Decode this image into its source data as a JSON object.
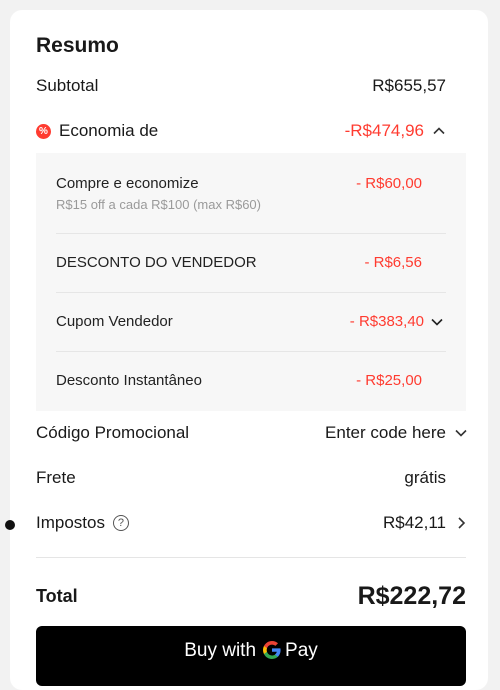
{
  "summary": {
    "title": "Resumo",
    "subtotal_label": "Subtotal",
    "subtotal_value": "R$655,57",
    "savings_label": "Economia de",
    "savings_value": "-R$474,96",
    "discounts": [
      {
        "label": "Compre e economize",
        "sub": "R$15 off a cada R$100 (max R$60)",
        "value": "- R$60,00"
      },
      {
        "label": "DESCONTO DO VENDEDOR",
        "value": "- R$6,56"
      },
      {
        "label": "Cupom Vendedor",
        "value": "- R$383,40"
      },
      {
        "label": "Desconto Instantâneo",
        "value": "- R$25,00"
      }
    ],
    "promo_label": "Código Promocional",
    "promo_placeholder": "Enter code here",
    "shipping_label": "Frete",
    "shipping_value": "grátis",
    "tax_label": "Impostos",
    "tax_value": "R$42,11",
    "total_label": "Total",
    "total_value": "R$222,72"
  },
  "payment": {
    "button_prefix": "Buy with",
    "button_suffix": "Pay"
  },
  "colors": {
    "accent_red": "#ff3b30",
    "button_bg": "#000000"
  },
  "icons": [
    "savings-badge-icon",
    "chevron-up-icon",
    "chevron-down-icon",
    "help-icon",
    "chevron-right-icon",
    "google-g-icon"
  ]
}
